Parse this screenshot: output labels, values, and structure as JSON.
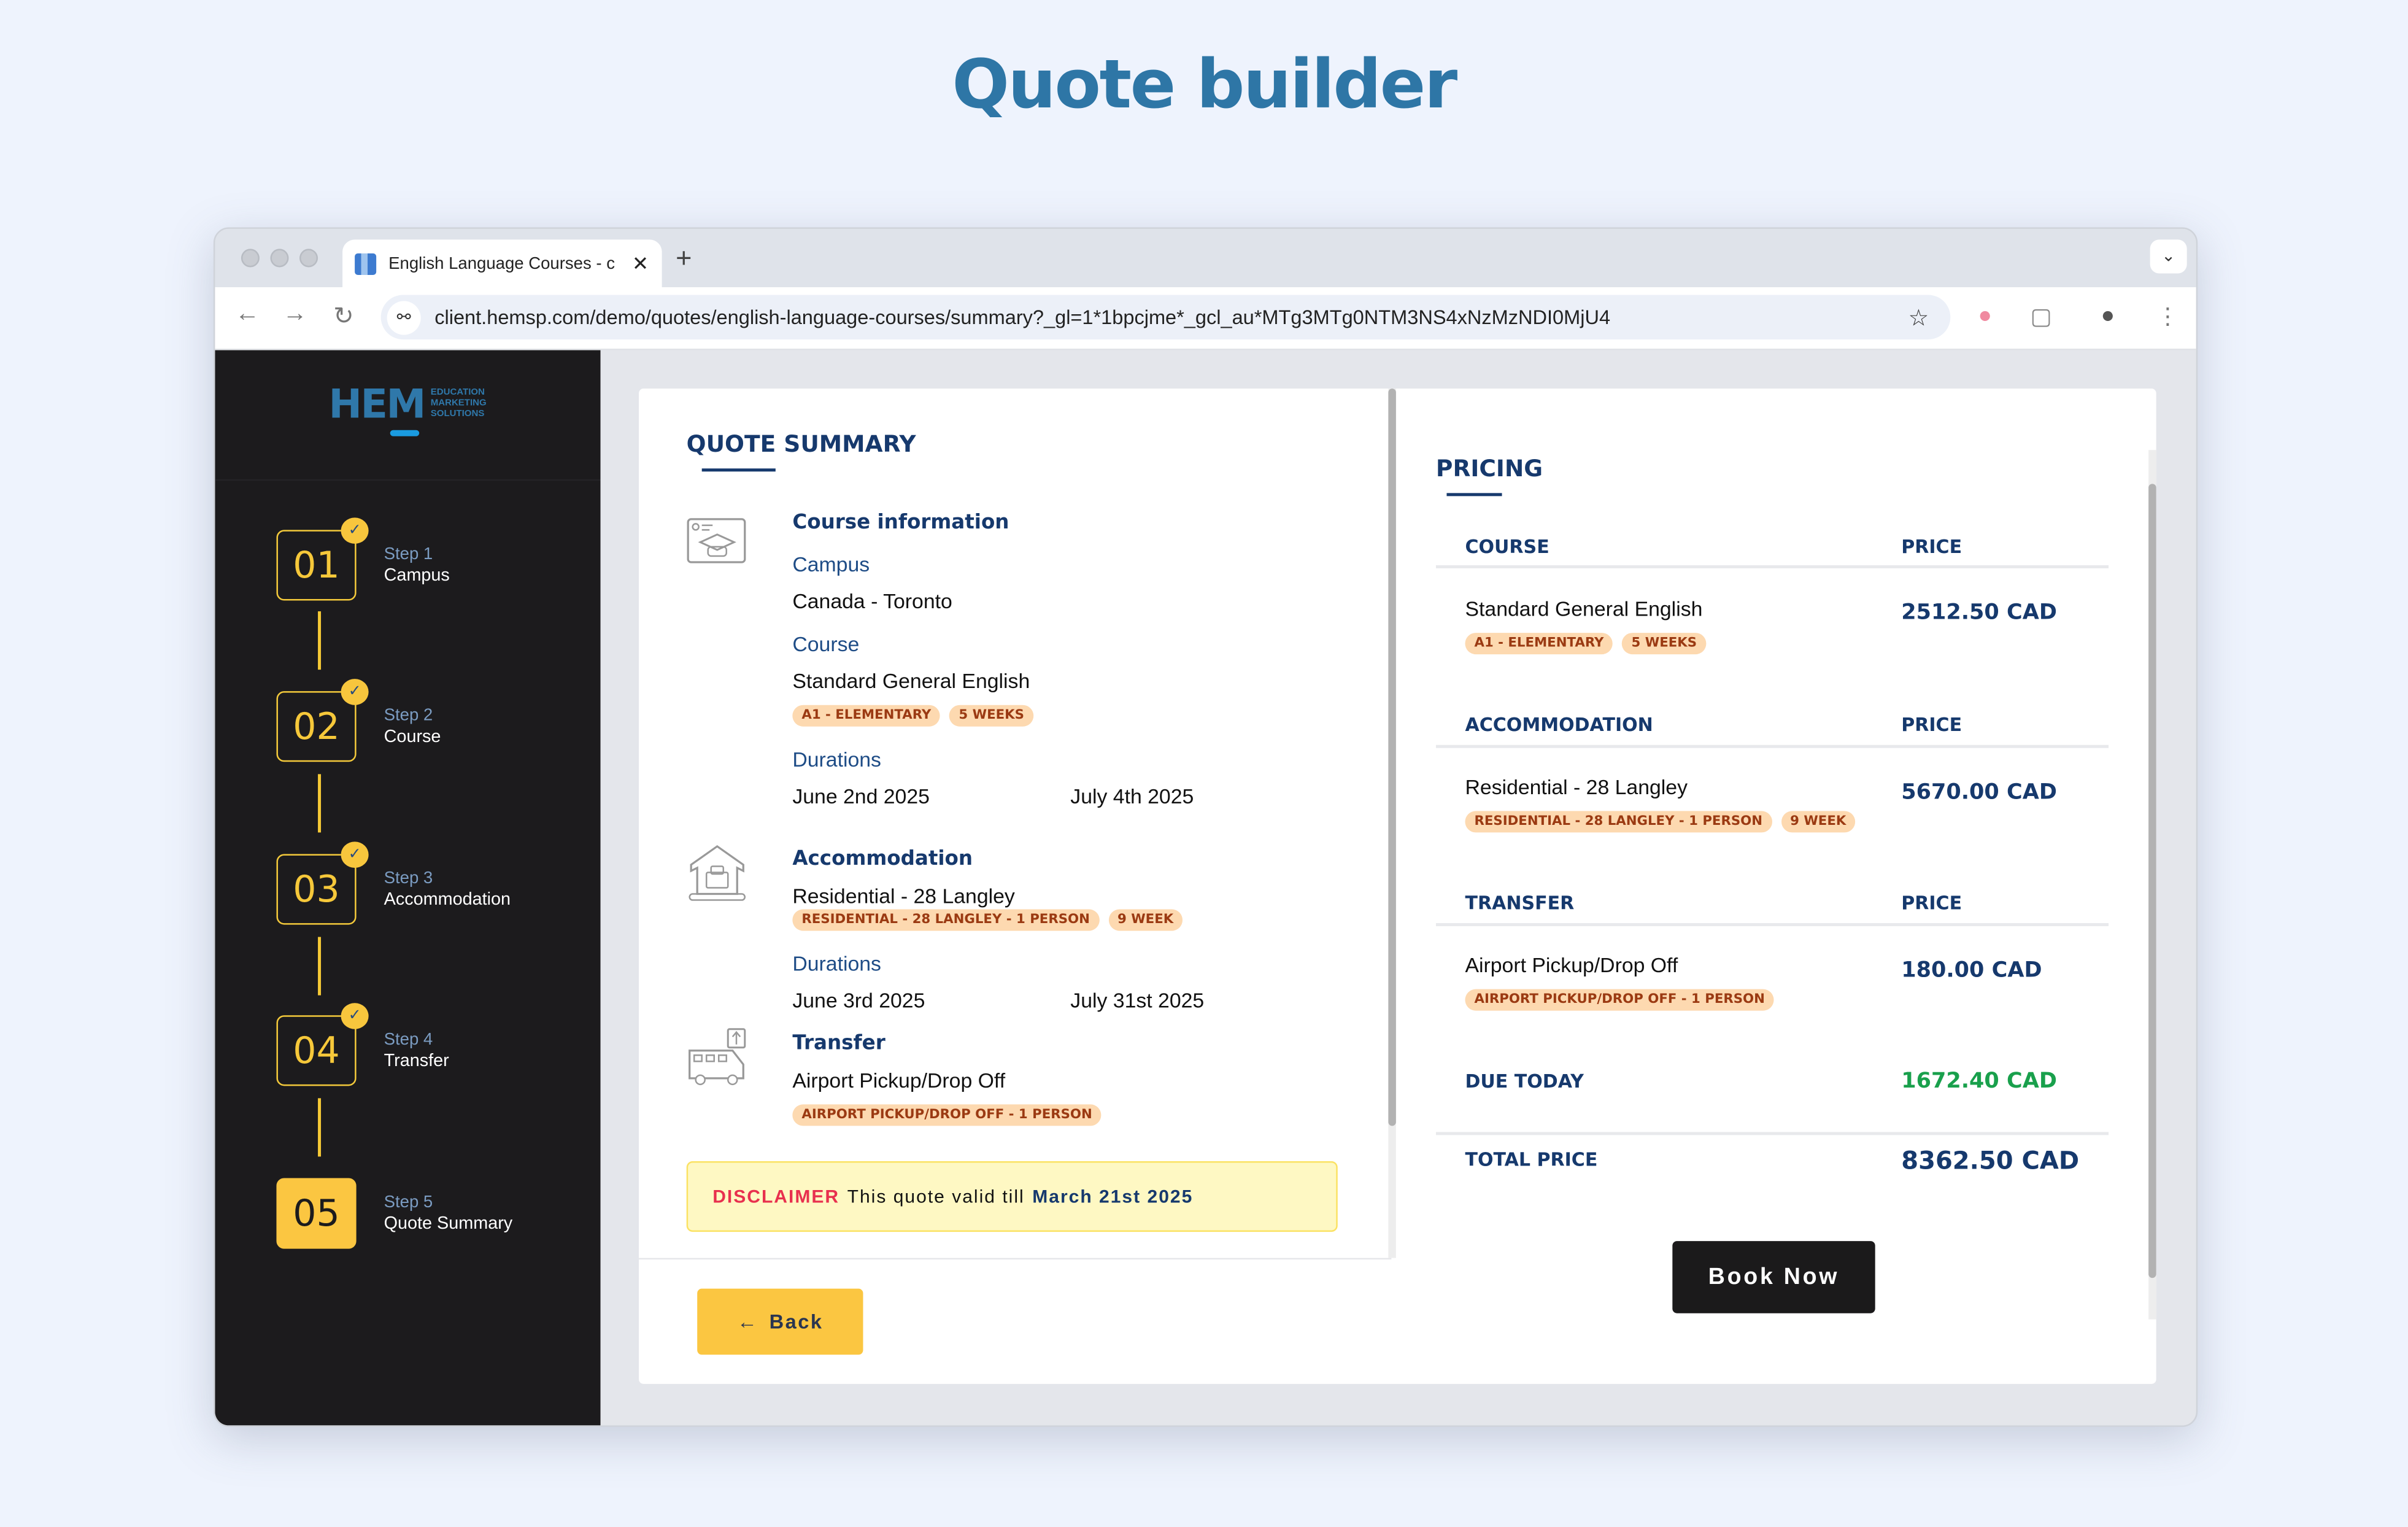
{
  "page": {
    "title": "Quote builder"
  },
  "browser": {
    "tab_title": "English Language Courses - c",
    "url": "client.hemsp.com/demo/quotes/english-language-courses/summary?_gl=1*1bpcjme*_gcl_au*MTg3MTg0NTM3NS4xNzMzNDI0MjU4",
    "icons": {
      "back": "←",
      "forward": "→",
      "reload": "↻",
      "tune": "⚯",
      "star": "☆",
      "close": "✕",
      "new_tab": "+",
      "menu": "⌄",
      "kebab": "⋮"
    }
  },
  "sidebar": {
    "logo": {
      "main": "HEM",
      "sub1": "EDUCATION",
      "sub2": "MARKETING",
      "sub3": "SOLUTIONS"
    },
    "steps": [
      {
        "number": "01",
        "label": "Step 1",
        "name": "Campus",
        "completed": true,
        "active": false
      },
      {
        "number": "02",
        "label": "Step 2",
        "name": "Course",
        "completed": true,
        "active": false
      },
      {
        "number": "03",
        "label": "Step 3",
        "name": "Accommodation",
        "completed": true,
        "active": false
      },
      {
        "number": "04",
        "label": "Step 4",
        "name": "Transfer",
        "completed": true,
        "active": false
      },
      {
        "number": "05",
        "label": "Step 5",
        "name": "Quote Summary",
        "completed": false,
        "active": true
      }
    ],
    "check_glyph": "✓"
  },
  "summary": {
    "heading": "QUOTE SUMMARY",
    "course": {
      "title": "Course information",
      "campus_label": "Campus",
      "campus_value": "Canada - Toronto",
      "course_label": "Course",
      "course_value": "Standard General English",
      "chips": [
        "A1 - ELEMENTARY",
        "5 WEEKS"
      ],
      "durations_label": "Durations",
      "start": "June 2nd 2025",
      "end": "July 4th 2025"
    },
    "accommodation": {
      "title": "Accommodation",
      "value": "Residential - 28 Langley",
      "chips": [
        "RESIDENTIAL - 28 LANGLEY - 1 PERSON",
        "9 WEEK"
      ],
      "durations_label": "Durations",
      "start": "June 3rd 2025",
      "end": "July 31st 2025"
    },
    "transfer": {
      "title": "Transfer",
      "value": "Airport Pickup/Drop Off",
      "chips": [
        "AIRPORT PICKUP/DROP OFF - 1 PERSON"
      ]
    },
    "disclaimer": {
      "label": "DISCLAIMER",
      "text": "This quote valid till",
      "date": "March 21st 2025"
    },
    "back_button": "Back",
    "back_arrow": "←"
  },
  "pricing": {
    "heading": "PRICING",
    "price_header": "PRICE",
    "sections": [
      {
        "header": "COURSE",
        "name": "Standard General English",
        "chips": [
          "A1 - ELEMENTARY",
          "5 WEEKS"
        ],
        "price": "2512.50 CAD"
      },
      {
        "header": "ACCOMMODATION",
        "name": "Residential - 28 Langley",
        "chips": [
          "RESIDENTIAL - 28 LANGLEY - 1 PERSON",
          "9 WEEK"
        ],
        "price": "5670.00 CAD"
      },
      {
        "header": "TRANSFER",
        "name": "Airport Pickup/Drop Off",
        "chips": [
          "AIRPORT PICKUP/DROP OFF - 1 PERSON"
        ],
        "price": "180.00 CAD"
      }
    ],
    "due_today_label": "DUE TODAY",
    "due_today_value": "1672.40 CAD",
    "total_label": "TOTAL PRICE",
    "total_value": "8362.50 CAD",
    "book_button": "Book Now"
  },
  "colors": {
    "accent_yellow": "#fbc641",
    "navy": "#16396d",
    "green": "#19a04c",
    "disclaimer_red": "#e8304e",
    "chip_bg": "#fdd9b0",
    "chip_text": "#9b3a12"
  }
}
